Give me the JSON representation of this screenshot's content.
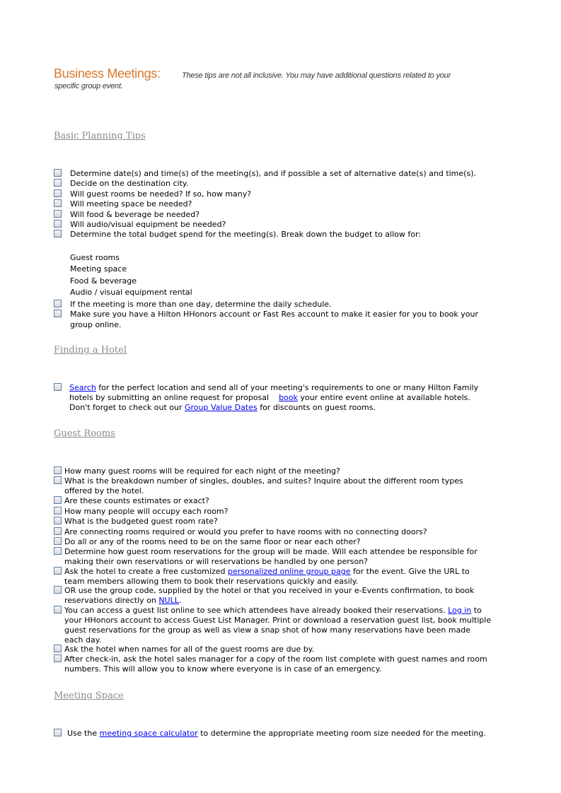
{
  "header": {
    "title": "Business Meetings:",
    "intro_line1": "These tips are not all inclusive. You may have additional questions related to your",
    "intro_line2": "specific group event."
  },
  "sections": {
    "basic": {
      "heading": "Basic Planning Tips",
      "items": [
        "Determine date(s) and time(s) of the meeting(s), and if possible a set of alternative date(s) and time(s).",
        "Decide on the destination city.",
        "Will guest rooms be needed? If so, how many?",
        "Will meeting space be needed?",
        "Will food & beverage be needed?",
        "Will audio/visual equipment be needed?",
        "Determine the total budget spend for the meeting(s). Break down the budget to allow for:"
      ],
      "budget_items": [
        "Guest rooms",
        "Meeting space",
        "Food & beverage",
        "Audio / visual equipment rental"
      ],
      "items_after": [
        "If the meeting is more than one day, determine the daily schedule.",
        "Make sure you have a Hilton HHonors account or Fast Res account to make it easier for you to book your",
        "group online."
      ]
    },
    "hotel": {
      "heading": "Finding a Hotel",
      "link_search": "Search",
      "text1": " for the perfect location and send all of your meeting's requirements to one or many Hilton Family",
      "text2": "hotels by submitting an online request for proposal",
      "link_book": "book",
      "text3": " your entire event online at available hotels.",
      "text4": "Don't forget to check out our ",
      "link_gvd": "Group Value Dates",
      "text5": " for discounts on guest rooms."
    },
    "rooms": {
      "heading": "Guest Rooms",
      "q1": "How many guest rooms will be required for each night of the meeting?",
      "q2a": "What is the breakdown number of singles, doubles, and suites? Inquire about the different room types",
      "q2b": "offered by the hotel.",
      "q3": "Are these counts estimates or exact?",
      "q4": "How many people will occupy each room?",
      "q5": "What is the budgeted guest room rate?",
      "q6": "Are connecting rooms required or would you prefer to have rooms with no connecting doors?",
      "q7": "Do all or any of the rooms need to be on the same floor or near each other?",
      "q8a": "Determine how guest room reservations for the group will be made. Will each attendee be responsible for",
      "q8b": "making their own reservations or will reservations be handled by one person?",
      "q9a_pre": "Ask the hotel to create a free customized ",
      "q9a_link": "personalized online group page",
      "q9a_post": " for the event. Give the URL to",
      "q9b": "team members allowing them to book their reservations quickly and easily.",
      "q10a": "OR use the group code, supplied by the hotel or that you received in your e-Events confirmation, to book",
      "q10b_pre": "reservations directly on ",
      "q10b_link": "NULL",
      "q10b_post": ".",
      "q11a_pre": "You can access a guest list online to see which attendees have already booked their reservations. ",
      "q11a_link": "Log in",
      "q11a_post": " to",
      "q11b": "your HHonors account to access Guest List Manager. Print or download a reservation guest list, book multiple",
      "q11c": "guest reservations for the group as well as view a snap shot of how many reservations have been made",
      "q11d": "each day.",
      "q12": "Ask the hotel when names for all of the guest rooms are due by.",
      "q13a": "After check-in, ask the hotel sales manager for a copy of the room list complete with guest names and room",
      "q13b": "numbers. This will allow you to know where everyone is in case of an emergency."
    },
    "space": {
      "heading": "Meeting Space",
      "pre": "Use the ",
      "link": "meeting space calculator",
      "post": " to determine the appropriate meeting room size needed for the meeting."
    }
  }
}
